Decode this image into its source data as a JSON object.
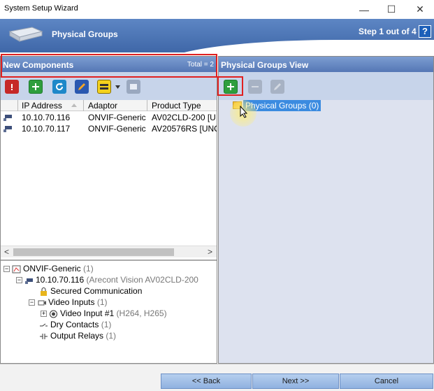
{
  "window": {
    "title": "System Setup Wizard",
    "min": "—",
    "max": "☐",
    "close": "✕"
  },
  "banner": {
    "title": "Physical Groups",
    "step": "Step 1 out of 4",
    "help": "?"
  },
  "left_panel": {
    "title": "New Components",
    "total": "Total = 2",
    "columns": [
      "IP Address",
      "Adaptor",
      "Product Type"
    ],
    "rows": [
      {
        "ip": "10.10.70.116",
        "adaptor": "ONVIF-Generic",
        "product": "AV02CLD-200 [U"
      },
      {
        "ip": "10.10.70.117",
        "adaptor": "ONVIF-Generic",
        "product": "AV20576RS [UNC"
      }
    ],
    "scroll_left": "<",
    "scroll_right": ">"
  },
  "tree": {
    "root_label": "ONVIF-Generic",
    "root_count": "(1)",
    "device_ip": "10.10.70.116",
    "device_model": "(Arecont Vision AV02CLD-200",
    "secured": "Secured Communication",
    "video_inputs": "Video Inputs",
    "video_inputs_count": "(1)",
    "video_input_1": "Video Input #1",
    "video_input_1_codec": "(H264, H265)",
    "dry_contacts": "Dry Contacts",
    "dry_contacts_count": "(1)",
    "output_relays": "Output Relays",
    "output_relays_count": "(1)"
  },
  "right_panel": {
    "title": "Physical Groups View",
    "node_label": "Physical Groups (0)"
  },
  "footer": {
    "back": "<< Back",
    "next": "Next >>",
    "cancel": "Cancel"
  }
}
